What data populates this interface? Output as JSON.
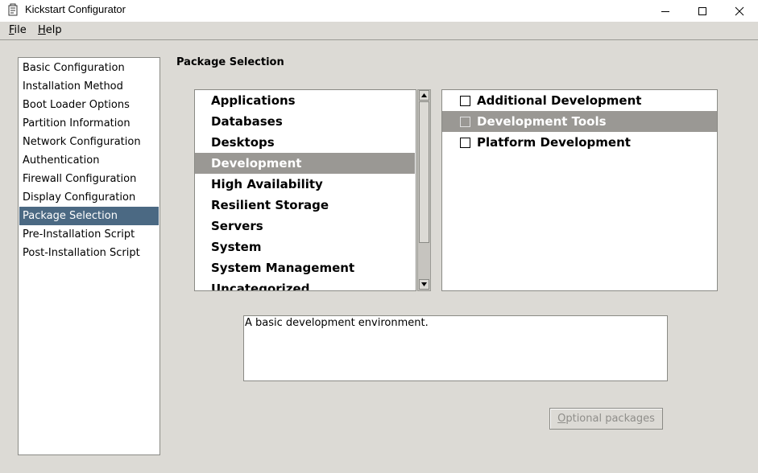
{
  "window": {
    "title": "Kickstart Configurator",
    "controls": [
      "minimize",
      "maximize",
      "close"
    ]
  },
  "menu": {
    "file_mnemonic": "F",
    "file_rest": "ile",
    "help_mnemonic": "H",
    "help_rest": "elp"
  },
  "sidebar": {
    "items": [
      "Basic Configuration",
      "Installation Method",
      "Boot Loader Options",
      "Partition Information",
      "Network Configuration",
      "Authentication",
      "Firewall Configuration",
      "Display Configuration",
      "Package Selection",
      "Pre-Installation Script",
      "Post-Installation Script"
    ],
    "selected": "Package Selection"
  },
  "main": {
    "heading": "Package Selection",
    "groups": [
      "Applications",
      "Databases",
      "Desktops",
      "Development",
      "High Availability",
      "Resilient Storage",
      "Servers",
      "System",
      "System Management",
      "Uncategorized"
    ],
    "selected_group": "Development",
    "packages": [
      {
        "label": "Additional Development",
        "checked": false
      },
      {
        "label": "Development Tools",
        "checked": false
      },
      {
        "label": "Platform Development",
        "checked": false
      }
    ],
    "selected_package": "Development Tools",
    "description": "A basic development environment.",
    "optional_button_mnemonic": "O",
    "optional_button_rest": "ptional packages"
  },
  "colors": {
    "sidebar_selected_bg": "#4b6983",
    "list_selected_bg": "#9a9894",
    "window_bg": "#dcdad5"
  }
}
